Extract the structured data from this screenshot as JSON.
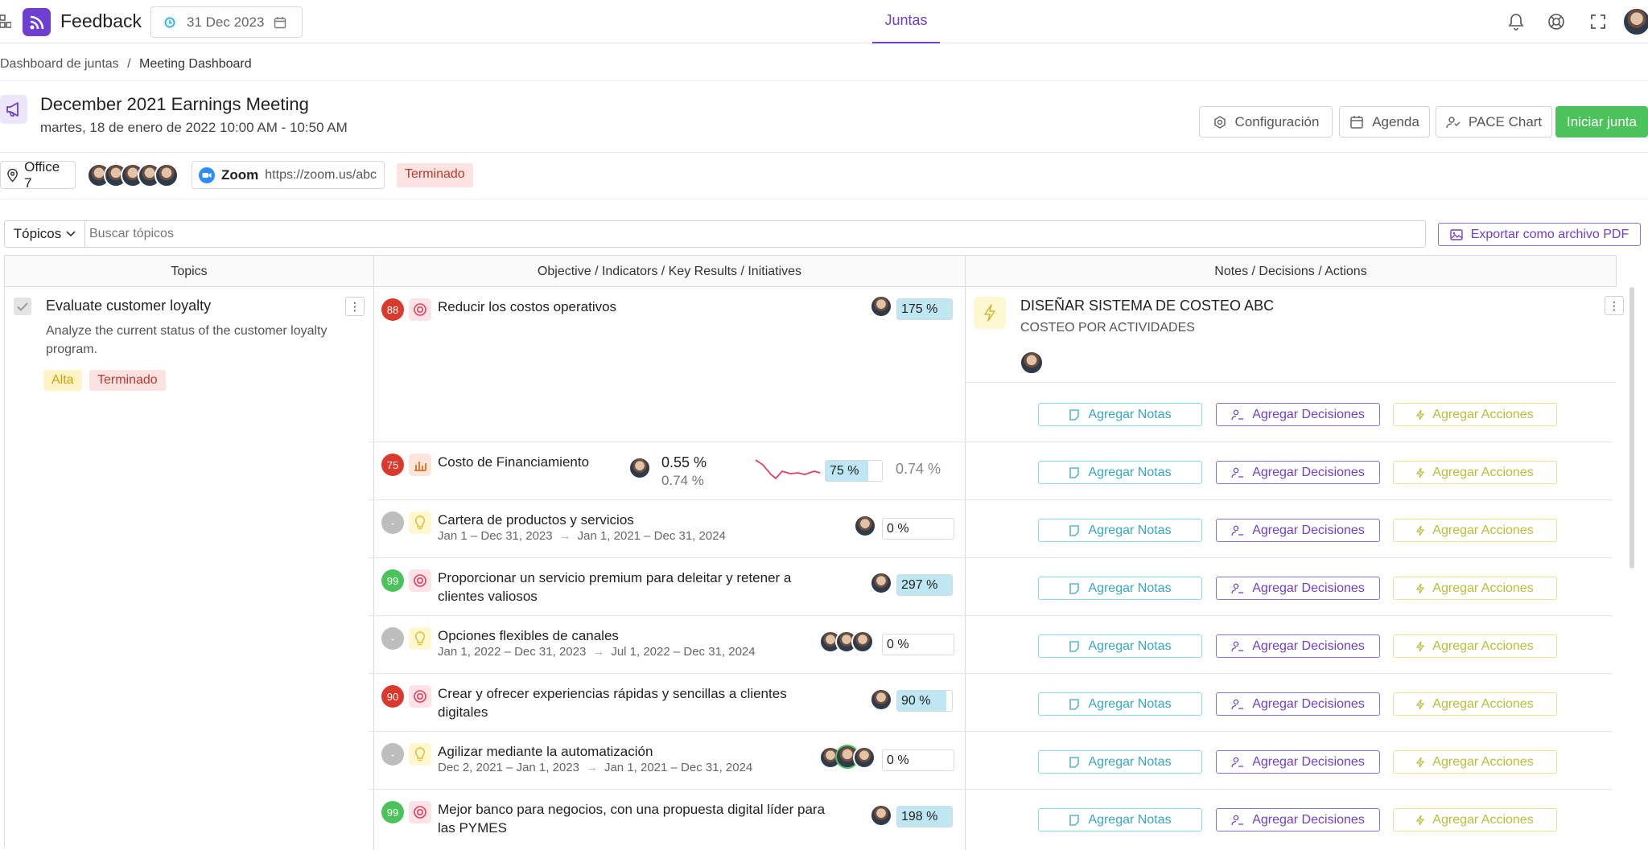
{
  "app": {
    "name": "Feedback",
    "date": "31 Dec 2023",
    "active_tab": "Juntas"
  },
  "icons": {
    "logo": "rss-icon",
    "bell": "bell-icon",
    "support": "lifebuoy-icon",
    "fullscreen": "fullscreen-icon"
  },
  "breadcrumb": {
    "first": "Dashboard de juntas",
    "separator": "/",
    "current": "Meeting Dashboard"
  },
  "meeting": {
    "title": "December 2021 Earnings Meeting",
    "datetime": "martes, 18 de enero de 2022 10:00 AM - 10:50 AM",
    "location": "Office 7",
    "zoom_label": "Zoom",
    "zoom_url": "https://zoom.us/abc",
    "status": "Terminado"
  },
  "actions": {
    "config": "Configuración",
    "agenda": "Agenda",
    "pace": "PACE Chart",
    "start": "Iniciar junta"
  },
  "filter": {
    "dropdown": "Tópicos",
    "search_placeholder": "Buscar tópicos",
    "export": "Exportar como archivo PDF"
  },
  "columns": {
    "topics": "Topics",
    "objectives": "Objective / Indicators / Key Results / Initiatives",
    "notes": "Notes / Decisions / Actions"
  },
  "topic": {
    "title": "Evaluate customer loyalty",
    "description": "Analyze the current status of the customer loyalty program.",
    "priority": "Alta",
    "status": "Terminado"
  },
  "note_card": {
    "title": "DISEÑAR SISTEMA DE COSTEO ABC",
    "subtitle": "COSTEO POR ACTIVIDADES"
  },
  "row_buttons": {
    "notes": "Agregar Notas",
    "decisions": "Agregar Decisiones",
    "actions": "Agregar Acciones"
  },
  "items": [
    {
      "score": "88",
      "score_color": "#d93a2b",
      "type": "objective",
      "title": "Reducir los costos operativos",
      "title2": "",
      "dates_a": "",
      "dates_b": "",
      "pct": "175 %",
      "progress": 100
    },
    {
      "score": "75",
      "score_color": "#d93a2b",
      "type": "indicator",
      "title": "Costo de Financiamiento",
      "title2": "",
      "dates_a": "",
      "dates_b": "",
      "pct": "75 %",
      "progress": 75,
      "actual": "0.55 %",
      "target": "0.74 %",
      "side_value": "0.74 %"
    },
    {
      "score": "-",
      "score_color": "#bdbdbd",
      "type": "initiative",
      "title": "Cartera de productos y servicios",
      "title2": "",
      "dates_a": "Jan 1 – Dec 31, 2023",
      "dates_b": "Jan 1, 2021 – Dec 31, 2024",
      "pct": "0 %",
      "progress": 0
    },
    {
      "score": "99",
      "score_color": "#4cc35a",
      "type": "objective",
      "title": "Proporcionar un servicio premium para deleitar y retener a",
      "title2": "clientes valiosos",
      "dates_a": "",
      "dates_b": "",
      "pct": "297 %",
      "progress": 100
    },
    {
      "score": "-",
      "score_color": "#bdbdbd",
      "type": "initiative",
      "title": "Opciones flexibles de canales",
      "title2": "",
      "dates_a": "Jan 1, 2022 – Dec 31, 2023",
      "dates_b": "Jul 1, 2022 – Dec 31, 2024",
      "pct": "0 %",
      "progress": 0
    },
    {
      "score": "90",
      "score_color": "#d93a2b",
      "type": "objective",
      "title": "Crear y ofrecer experiencias rápidas y sencillas a clientes",
      "title2": "digitales",
      "dates_a": "",
      "dates_b": "",
      "pct": "90 %",
      "progress": 90
    },
    {
      "score": "-",
      "score_color": "#bdbdbd",
      "type": "initiative",
      "title": "Agilizar mediante la automatización",
      "title2": "",
      "dates_a": "Dec 2, 2021 – Jan 1, 2023",
      "dates_b": "Jan 1, 2021 – Dec 31, 2024",
      "pct": "0 %",
      "progress": 0
    },
    {
      "score": "99",
      "score_color": "#4cc35a",
      "type": "objective",
      "title": "Mejor banco para negocios, con una propuesta digital líder para",
      "title2": "las PYMES",
      "dates_a": "",
      "dates_b": "",
      "pct": "198 %",
      "progress": 100
    }
  ],
  "colors": {
    "brand": "#6e3fd0",
    "start_button": "#4cc35a",
    "progress_fill": "#bfe6f3",
    "danger": "#d93a2b",
    "success": "#4cc35a"
  }
}
